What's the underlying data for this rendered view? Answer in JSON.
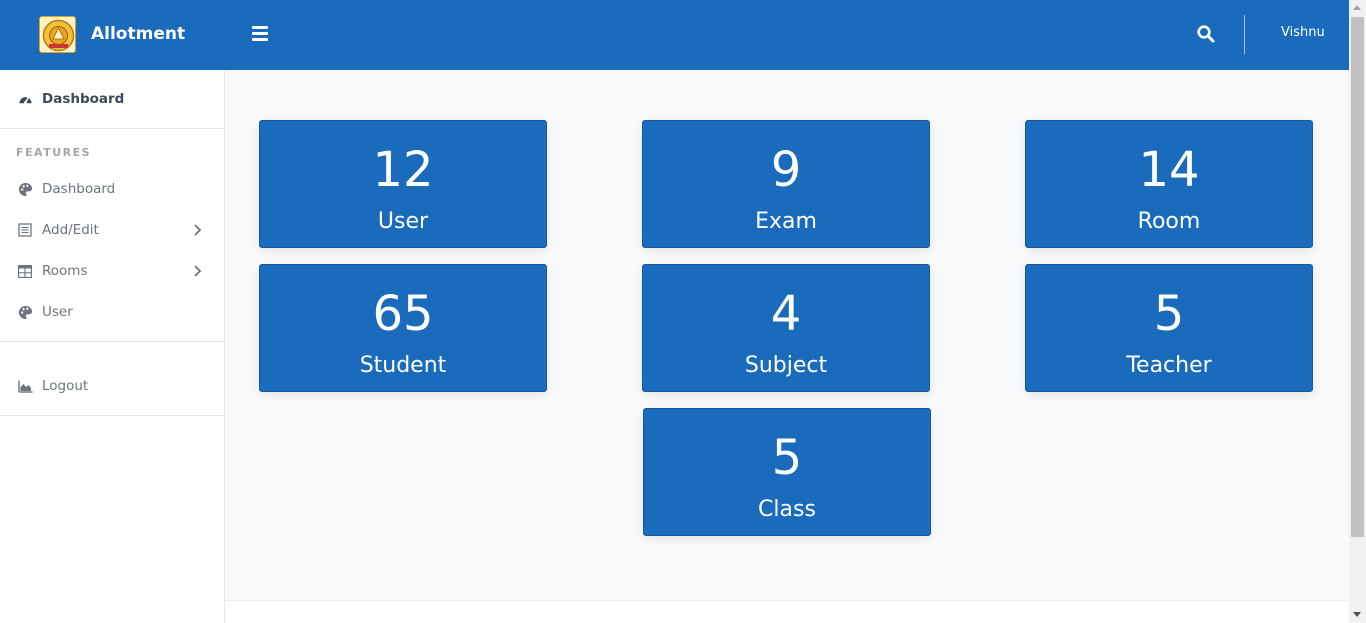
{
  "header": {
    "brand": "Allotment",
    "user_name": "Vishnu",
    "menu_icon": "hamburger-icon",
    "search_icon": "search-icon",
    "bar_color": "#1a6bbb"
  },
  "sidebar": {
    "top_item": {
      "label": "Dashboard",
      "icon": "tachometer-icon"
    },
    "section_heading": "FEATURES",
    "items": [
      {
        "label": "Dashboard",
        "icon": "palette-icon"
      },
      {
        "label": "Add/Edit",
        "icon": "list-icon",
        "has_submenu": true
      },
      {
        "label": "Rooms",
        "icon": "table-icon",
        "has_submenu": true
      },
      {
        "label": "User",
        "icon": "palette-icon"
      }
    ],
    "logout": {
      "label": "Logout",
      "icon": "area-chart-icon"
    }
  },
  "stats": [
    {
      "value": "12",
      "label": "User"
    },
    {
      "value": "9",
      "label": "Exam"
    },
    {
      "value": "14",
      "label": "Room"
    },
    {
      "value": "65",
      "label": "Student"
    },
    {
      "value": "4",
      "label": "Subject"
    },
    {
      "value": "5",
      "label": "Teacher"
    },
    {
      "value": "5",
      "label": "Class"
    }
  ]
}
